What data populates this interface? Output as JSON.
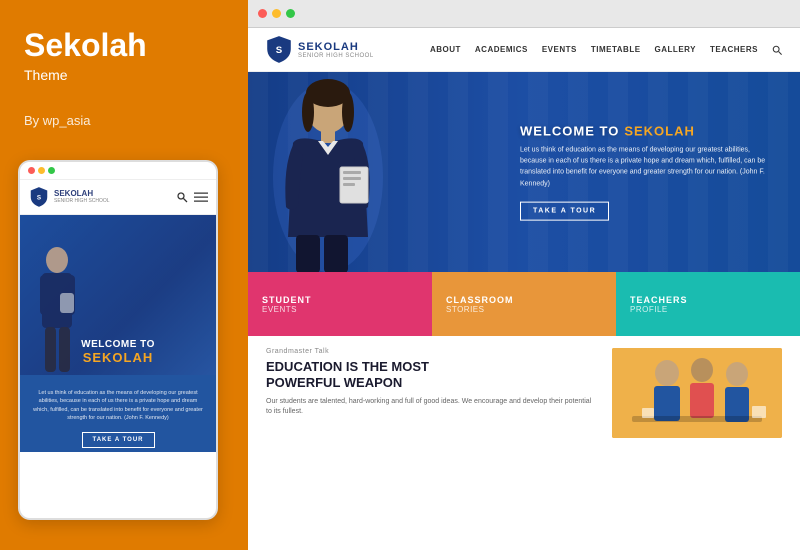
{
  "left": {
    "title": "Sekolah",
    "subtitle": "Theme",
    "author": "By wp_asia"
  },
  "browser": {
    "dots": [
      "#fc5c57",
      "#fdbc2c",
      "#33c748"
    ]
  },
  "desktop_nav": {
    "logo_main": "SEKOLAH",
    "logo_sub": "SENIOR HIGH SCHOOL",
    "links": [
      "ABOUT",
      "ACADEMICS",
      "EVENTS",
      "TIMETABLE",
      "GALLERY",
      "TEACHERS"
    ]
  },
  "hero": {
    "welcome": "WELCOME TO",
    "brand": "SEKOLAH",
    "description": "Let us think of education as the means of developing our greatest abilities, because in each of us there is a private hope and dream which, fulfilled, can be translated into benefit for everyone and greater strength for our nation. (John F. Kennedy)",
    "cta": "TAKE A TOUR"
  },
  "feature_boxes": [
    {
      "title": "STUDENT",
      "sub": "EVENTS",
      "color": "#e0356e"
    },
    {
      "title": "CLASSROOM",
      "sub": "STORIES",
      "color": "#f5a623"
    },
    {
      "title": "TEACHERS",
      "sub": "PROFILE",
      "color": "#1abcb0"
    }
  ],
  "content": {
    "tag": "Grandmaster Talk",
    "headline_line1": "EDUCATION IS THE MOST",
    "headline_line2": "POWERFUL WEAPON",
    "body": "Our students are talented, hard-working and full of good ideas. We encourage and develop their potential to its fullest."
  },
  "mobile": {
    "logo_main": "SEKOLAH",
    "logo_sub": "SENIOR HIGH SCHOOL",
    "welcome": "WELCOME TO",
    "brand": "SEKOLAH",
    "description": "Let us think of education as the means of developing our greatest abilities, because in each of us there is a private hope and dream which, fulfilled, can be translated into benefit for everyone and greater strength for our nation. (John F. Kennedy)",
    "cta": "TAKE A TOUR"
  },
  "colors": {
    "orange": "#e07b00",
    "blue_dark": "#1a3a80",
    "blue_mid": "#2563c9",
    "yellow": "#f5a623",
    "pink": "#e0356e",
    "teal": "#1abcb0"
  }
}
